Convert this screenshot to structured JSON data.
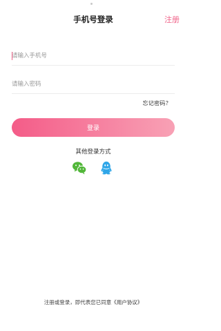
{
  "nav": {
    "title": "手机号登录",
    "register_label": "注册"
  },
  "form": {
    "phone_placeholder": "请输入手机号",
    "password_placeholder": "请输入密码",
    "forgot_label": "忘记密码？",
    "login_label": "登录"
  },
  "social": {
    "title": "其他登录方式",
    "icons": [
      "wechat-icon",
      "qq-icon"
    ]
  },
  "footer": {
    "agreement_prefix": "注册或登录，即代表您已同意",
    "agreement_link": "《用户协议》"
  },
  "colors": {
    "accent": "#f06389",
    "button_start": "#f45c88",
    "button_end": "#f8a1b5",
    "wechat": "#52b73a",
    "qq": "#2fa6e8"
  }
}
